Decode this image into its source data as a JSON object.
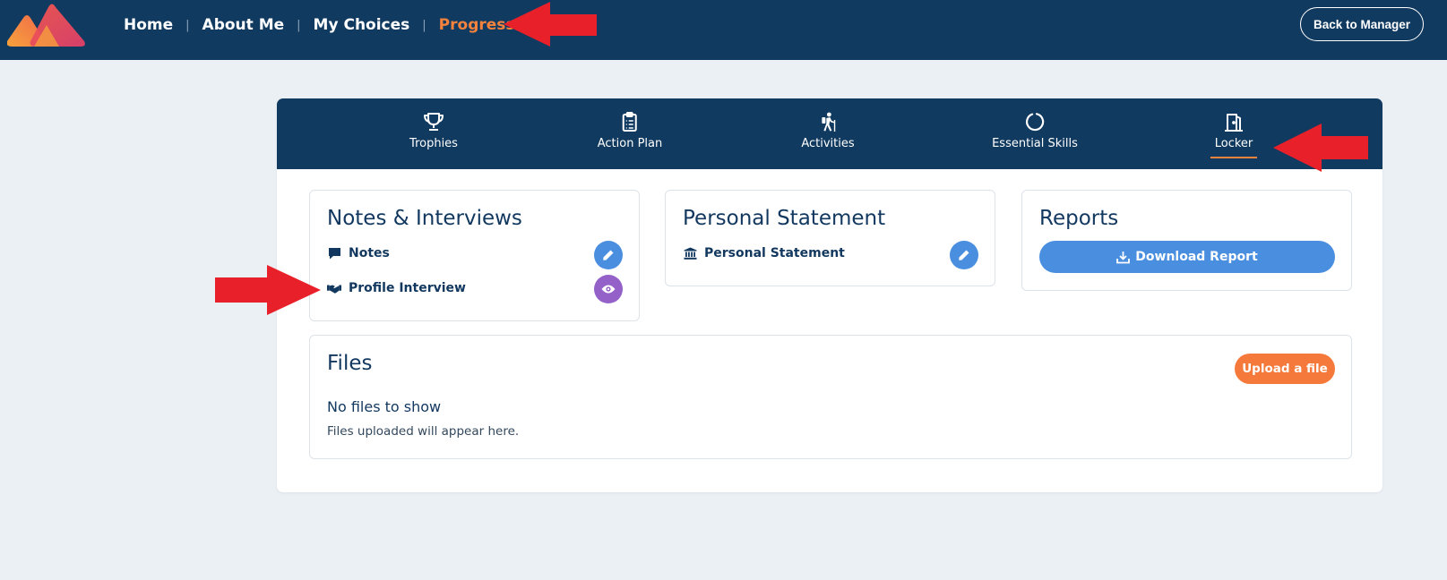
{
  "app": {
    "logo_icon": "brand-logo-icon",
    "colors": {
      "navy": "#113a60",
      "accent_orange": "#f5823d",
      "button_blue": "#4a8ee0",
      "button_purple": "#9461c9",
      "annotation_red": "#e8202a"
    }
  },
  "header": {
    "nav": [
      {
        "label": "Home",
        "active": false
      },
      {
        "label": "About Me",
        "active": false
      },
      {
        "label": "My Choices",
        "active": false
      },
      {
        "label": "Progress",
        "active": true
      }
    ],
    "separator": "|",
    "back_label": "Back to Manager"
  },
  "tabs": [
    {
      "label": "Trophies",
      "icon": "trophy-icon",
      "active": false
    },
    {
      "label": "Action Plan",
      "icon": "clipboard-list-icon",
      "active": false
    },
    {
      "label": "Activities",
      "icon": "hiker-icon",
      "active": false
    },
    {
      "label": "Essential Skills",
      "icon": "circle-ring-icon",
      "active": false
    },
    {
      "label": "Locker",
      "icon": "locker-door-icon",
      "active": true
    }
  ],
  "notes_panel": {
    "title": "Notes & Interviews",
    "items": [
      {
        "label": "Notes",
        "icon": "speech-bubble-icon",
        "action_icon": "pencil-icon"
      },
      {
        "label": "Profile Interview",
        "icon": "handshake-icon",
        "action_icon": "eye-icon"
      }
    ]
  },
  "statement_panel": {
    "title": "Personal Statement",
    "items": [
      {
        "label": "Personal Statement",
        "icon": "institution-icon",
        "action_icon": "pencil-icon"
      }
    ]
  },
  "reports_panel": {
    "title": "Reports",
    "download_label": "Download Report",
    "download_icon": "download-tray-icon"
  },
  "files_panel": {
    "title": "Files",
    "upload_label": "Upload a file",
    "empty_title": "No files to show",
    "empty_description": "Files uploaded will appear here."
  }
}
